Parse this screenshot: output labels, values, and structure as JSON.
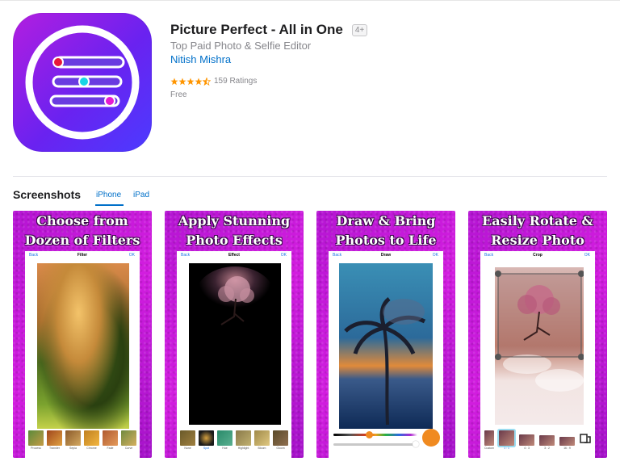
{
  "app": {
    "title": "Picture Perfect - All in One",
    "age_rating": "4+",
    "subtitle": "Top Paid Photo & Selfie Editor",
    "developer": "Nitish Mishra",
    "rating_value": 4.5,
    "ratings_text": "159 Ratings",
    "price": "Free"
  },
  "screenshots_section": {
    "heading": "Screenshots",
    "tabs": [
      {
        "label": "iPhone",
        "selected": true
      },
      {
        "label": "iPad",
        "selected": false
      }
    ]
  },
  "screenshots": [
    {
      "caption_line1": "Choose from",
      "caption_line2": "Dozen of  Filters",
      "nav": {
        "back": "Back",
        "title": "Filter",
        "ok": "OK"
      },
      "thumbs": [
        "Process",
        "Transfer",
        "Sepia",
        "Chrome",
        "Fade",
        "Curve"
      ]
    },
    {
      "caption_line1": "Apply Stunning",
      "caption_line2": "Photo Effects",
      "nav": {
        "back": "Back",
        "title": "Effect",
        "ok": "OK"
      },
      "thumbs": [
        "None",
        "Spot",
        "Hue",
        "Highlight",
        "Bloom",
        "Gloom"
      ]
    },
    {
      "caption_line1": "Draw & Bring",
      "caption_line2": "Photos to Life",
      "nav": {
        "back": "Back",
        "title": "Draw",
        "ok": "OK"
      }
    },
    {
      "caption_line1": "Easily Rotate &",
      "caption_line2": "Resize Photo",
      "nav": {
        "back": "Back",
        "title": "Crop",
        "ok": "OK"
      },
      "thumbs": [
        "Custom",
        "1 : 1",
        "4 : 3",
        "3 : 2",
        "16 : 9"
      ]
    }
  ],
  "colors": {
    "link_blue": "#0070c9",
    "star_orange": "#ff9500",
    "screenshot_purple": "#c318d6"
  }
}
